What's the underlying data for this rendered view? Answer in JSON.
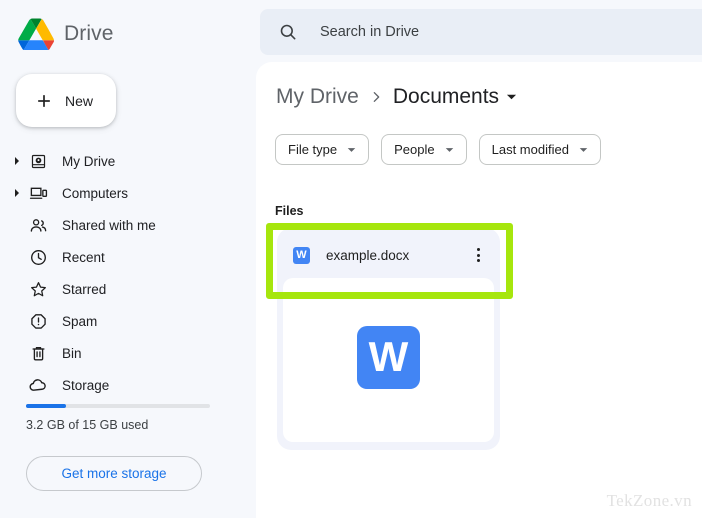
{
  "app": {
    "name": "Drive",
    "logo_icon": "google-drive-logo"
  },
  "sidebar": {
    "new_button": {
      "label": "New",
      "icon": "plus-icon"
    },
    "items": [
      {
        "label": "My Drive",
        "icon": "drive-icon",
        "expandable": true
      },
      {
        "label": "Computers",
        "icon": "computer-icon",
        "expandable": true
      },
      {
        "label": "Shared with me",
        "icon": "people-icon",
        "expandable": false
      },
      {
        "label": "Recent",
        "icon": "clock-icon",
        "expandable": false
      },
      {
        "label": "Starred",
        "icon": "star-icon",
        "expandable": false
      },
      {
        "label": "Spam",
        "icon": "exclamation-octagon-icon",
        "expandable": false
      },
      {
        "label": "Bin",
        "icon": "trash-icon",
        "expandable": false
      },
      {
        "label": "Storage",
        "icon": "cloud-icon",
        "expandable": false
      }
    ],
    "storage": {
      "used_text": "3.2 GB of 15 GB used",
      "percent_used": 22,
      "bar_color": "#1a73e8",
      "button_label": "Get more storage"
    }
  },
  "search": {
    "placeholder": "Search in Drive",
    "icon": "search-icon",
    "value": ""
  },
  "main": {
    "breadcrumb": {
      "root": "My Drive",
      "separator_icon": "chevron-right-icon",
      "current": "Documents",
      "caret_icon": "chevron-down-icon"
    },
    "filters": [
      {
        "label": "File type",
        "caret_icon": "chevron-down-icon"
      },
      {
        "label": "People",
        "caret_icon": "chevron-down-icon"
      },
      {
        "label": "Last modified",
        "caret_icon": "chevron-down-icon"
      }
    ],
    "section_label": "Files",
    "files": [
      {
        "name": "example.docx",
        "type_badge": "W",
        "badge_color": "#4285f4",
        "menu_icon": "kebab-menu-icon",
        "thumbnail_glyph": "W"
      }
    ],
    "highlight": {
      "color": "#a6e60d"
    }
  },
  "watermark": "TekZone.vn"
}
